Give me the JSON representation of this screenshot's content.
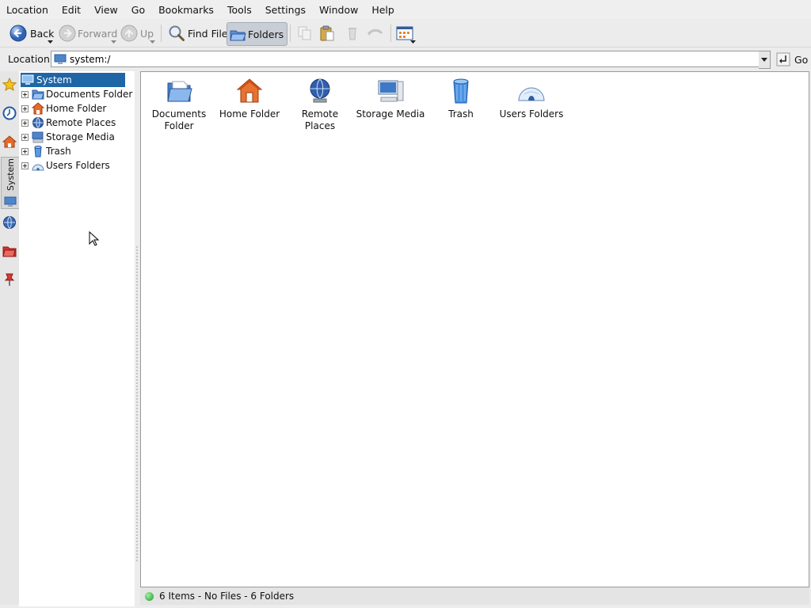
{
  "menubar": {
    "items": [
      {
        "label": "Location"
      },
      {
        "label": "Edit"
      },
      {
        "label": "View"
      },
      {
        "label": "Go"
      },
      {
        "label": "Bookmarks"
      },
      {
        "label": "Tools"
      },
      {
        "label": "Settings"
      },
      {
        "label": "Window"
      },
      {
        "label": "Help"
      }
    ]
  },
  "toolbar": {
    "back_label": "Back",
    "forward_label": "Forward",
    "up_label": "Up",
    "find_label": "Find File",
    "folders_label": "Folders"
  },
  "location": {
    "label": "Location:",
    "value": "system:/",
    "go_label": "Go"
  },
  "sidebar": {
    "vertical_tab_label": "System"
  },
  "tree": {
    "root": "System",
    "items": [
      {
        "label": "Documents Folder"
      },
      {
        "label": "Home Folder"
      },
      {
        "label": "Remote Places"
      },
      {
        "label": "Storage Media"
      },
      {
        "label": "Trash"
      },
      {
        "label": "Users Folders"
      }
    ]
  },
  "main": {
    "items": [
      {
        "label": "Documents Folder",
        "icon": "documents-folder-icon"
      },
      {
        "label": "Home Folder",
        "icon": "home-folder-icon"
      },
      {
        "label": "Remote Places",
        "icon": "remote-places-icon"
      },
      {
        "label": "Storage Media",
        "icon": "storage-media-icon"
      },
      {
        "label": "Trash",
        "icon": "trash-icon"
      },
      {
        "label": "Users Folders",
        "icon": "users-folders-icon"
      }
    ]
  },
  "status": {
    "text": "6 Items - No Files - 6 Folders"
  }
}
